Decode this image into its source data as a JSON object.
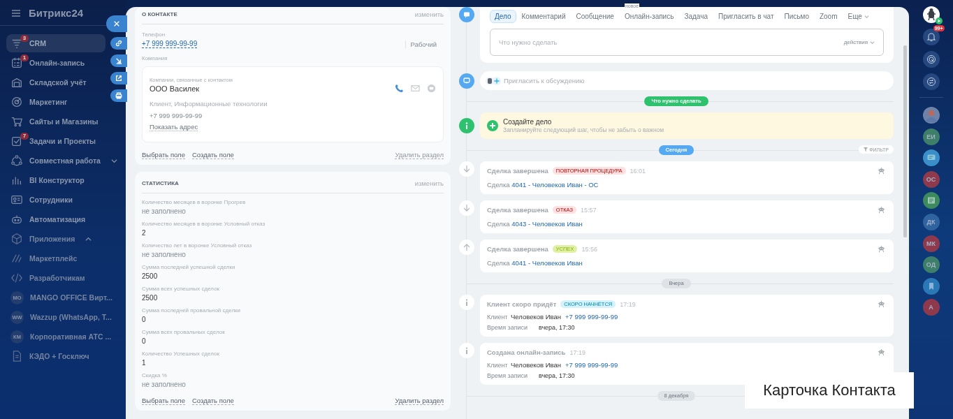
{
  "sidebar": {
    "logo": "Битрикс24",
    "items": [
      {
        "label": "CRM",
        "badge": "3",
        "selected": true,
        "faded": false
      },
      {
        "label": "Онлайн-запись",
        "badge": "1",
        "selected": false,
        "faded": false
      },
      {
        "label": "Складской учёт",
        "selected": false,
        "faded": false
      },
      {
        "label": "Маркетинг",
        "selected": false,
        "faded": false
      },
      {
        "label": "Сайты и Магазины",
        "selected": false,
        "faded": false
      },
      {
        "label": "Задачи и Проекты",
        "badge": "7",
        "selected": false,
        "faded": false
      },
      {
        "label": "Совместная работа",
        "expanded": false,
        "selected": false,
        "faded": false
      },
      {
        "label": "BI Конструктор",
        "selected": false,
        "faded": false
      },
      {
        "label": "Сотрудники",
        "selected": false,
        "faded": false
      },
      {
        "label": "Автоматизация",
        "selected": false,
        "faded": false
      },
      {
        "label": "Приложения",
        "expanded": true,
        "selected": false,
        "faded": true
      },
      {
        "label": "Маркетплейс",
        "selected": false,
        "faded": true
      },
      {
        "label": "Разработчикам",
        "selected": false,
        "faded": true
      },
      {
        "label": "MANGO OFFICE Вирт...",
        "icon_text": "MO",
        "selected": false,
        "faded": true
      },
      {
        "label": "Wazzup (WhatsApp, T...",
        "icon_text": "WW",
        "selected": false,
        "faded": true
      },
      {
        "label": "Корпоративная АТС ...",
        "icon_text": "КМ",
        "selected": false,
        "faded": true
      },
      {
        "label": "КЭДО + Госключ",
        "selected": false,
        "faded": true
      }
    ]
  },
  "side_actions": [
    {
      "kind": "close"
    },
    {
      "kind": "link"
    },
    {
      "kind": "download"
    },
    {
      "kind": "external"
    },
    {
      "kind": "print"
    }
  ],
  "contact_section": {
    "title": "О КОНТАКТЕ",
    "edit": "изменить",
    "phone_label": "Телефон",
    "phone": "+7 999 999-99-99",
    "phone_type": "Рабочий",
    "company_label": "Компания",
    "company": {
      "caption": "Компании, связанные с контактом",
      "name": "ООО Василек",
      "details": "Клиент, Информационные технологии",
      "phone": "+7 999 999-99-99",
      "address_link": "Показать адрес"
    },
    "footer": {
      "choose": "Выбрать поле",
      "create": "Создать поле",
      "delete": "Удалить раздел",
      "delete_disabled": true
    }
  },
  "stats_section": {
    "title": "СТАТИСТИКА",
    "edit": "изменить",
    "fields": [
      {
        "label": "Количество месяцев в воронке Прогрев",
        "value": "не заполнено",
        "empty": true
      },
      {
        "label": "Количество месяцев в воронке Условный отказ",
        "value": "2",
        "empty": false
      },
      {
        "label": "Количество лет в воронке Условный отказ",
        "value": "не заполнено",
        "empty": true
      },
      {
        "label": "Сумма последней успешной сделки",
        "value": "2500",
        "empty": false
      },
      {
        "label": "Сумма всех успешных сделок",
        "value": "2500",
        "empty": false
      },
      {
        "label": "Сумма последней провальной сделки",
        "value": "0",
        "empty": false
      },
      {
        "label": "Сумма всех провальных сделок",
        "value": "0",
        "empty": false
      },
      {
        "label": "Количество Успешных сделок",
        "value": "1",
        "empty": false
      },
      {
        "label": "Скидка %",
        "value": "не заполнено",
        "empty": true
      }
    ],
    "footer": {
      "choose": "Выбрать поле",
      "create": "Создать поле",
      "delete": "Удалить раздел",
      "delete_disabled": false
    }
  },
  "timeline": {
    "composer": {
      "tabs": [
        {
          "label": "Дело",
          "selected": true
        },
        {
          "label": "Комментарий",
          "selected": false
        },
        {
          "label": "Сообщение",
          "selected": false
        },
        {
          "label": "Онлайн-запись",
          "badge": "новое",
          "selected": false
        },
        {
          "label": "Задача",
          "selected": false
        },
        {
          "label": "Пригласить в чат",
          "selected": false
        },
        {
          "label": "Письмо",
          "selected": false
        },
        {
          "label": "Zoom",
          "selected": false
        },
        {
          "label": "Еще",
          "selected": false
        }
      ],
      "placeholder": "Что нужно сделать",
      "actions": "действия"
    },
    "invite": {
      "placeholder": "Пригласить к обсуждению"
    },
    "todo_divider": "Что нужно сделать",
    "create": {
      "title": "Создайте дело",
      "hint": "Запланируйте следующий шаг, чтобы не забыть о важном"
    },
    "today_divider": "Сегодня",
    "filter": "ФИЛЬТР",
    "groups": [
      {
        "items": [
          {
            "kind": "lost",
            "title": "Сделка завершена",
            "tag": {
              "text": "ПОВТОРНАЯ ПРОЦЕДУРА",
              "color": "#ffe1e1"
            },
            "time": "16:01",
            "prefix": "Сделка",
            "link": "4041 - Человеков Иван - ОС"
          },
          {
            "kind": "lost",
            "title": "Сделка завершена",
            "tag": {
              "text": "ОТКАЗ",
              "color": "#ffe1e1"
            },
            "time": "15:57",
            "prefix": "Сделка",
            "link": "4043 - Человеков Иван"
          },
          {
            "kind": "won",
            "title": "Сделка завершена",
            "tag": {
              "text": "УСПЕХ",
              "color": "#e0f0a6"
            },
            "time": "15:56",
            "prefix": "Сделка",
            "link": "4041 - Человеков Иван"
          }
        ]
      },
      {
        "divider": "Вчера",
        "items": [
          {
            "kind": "booking",
            "title": "Клиент скоро придёт",
            "tag": {
              "text": "СКОРО НАЧНЁТСЯ",
              "color": "#d4f2fb"
            },
            "time": "17:19",
            "client_label": "Клиент",
            "client": "Человеков Иван",
            "phone": "+7 999 999-99-99",
            "time_label": "Время записи",
            "slot": "вчера, 17:30"
          },
          {
            "kind": "booking",
            "title": "Создана онлайн-запись",
            "time": "17:19",
            "client_label": "Клиент",
            "client": "Человеков Иван",
            "phone": "+7 999 999-99-99",
            "time_label": "Время записи",
            "slot": "вчера, 17:30"
          }
        ]
      },
      {
        "divider": "8 декабря"
      }
    ]
  },
  "rail": {
    "top": [
      {
        "kind": "user"
      },
      {
        "kind": "bell",
        "badge": "99+"
      },
      {
        "kind": "dial"
      },
      {
        "kind": "swap"
      }
    ],
    "chats": [
      {
        "kind": "photo"
      },
      {
        "kind": "initials",
        "text": "ЕИ",
        "color": "#3d7f68"
      },
      {
        "kind": "chat"
      },
      {
        "kind": "initials",
        "text": "ОС",
        "color": "#8e3a4c"
      },
      {
        "kind": "notes"
      },
      {
        "kind": "initials",
        "text": "ДК",
        "color": "#2f64a0"
      },
      {
        "kind": "initials",
        "text": "МК",
        "color": "#8e3a4c"
      },
      {
        "kind": "initials",
        "text": "ОД",
        "color": "#3d7f68"
      },
      {
        "kind": "bookmark"
      },
      {
        "kind": "initials",
        "text": "А",
        "color": "#8e3a4c"
      }
    ]
  },
  "caption": "Карточка Контакта"
}
